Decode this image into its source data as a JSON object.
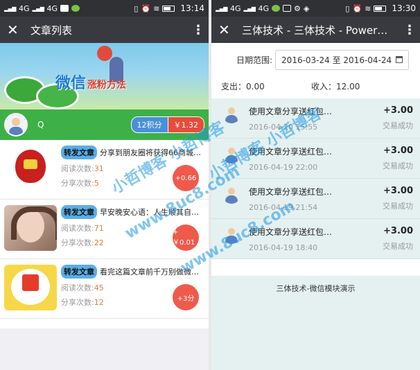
{
  "left": {
    "status": {
      "carrier1": "4G",
      "carrier2": "4G",
      "time": "13:14"
    },
    "nav": {
      "close": "✕",
      "title": "文章列表",
      "more": "⋮"
    },
    "banner": {
      "text": "微信",
      "subtext": "涨粉方法"
    },
    "user": {
      "name": "Q",
      "points": "12积分",
      "money": "￥1.32"
    },
    "articles": [
      {
        "tag": "转发文章",
        "title": "分享到朋友圈将获得66商城…",
        "read_label": "阅读次数:",
        "read": "31",
        "share_label": "分享次数:",
        "share": "5",
        "reward": "+0.66"
      },
      {
        "tag": "转发文章",
        "title": "早安晚安心语：人生顺其自…",
        "read_label": "阅读次数:",
        "read": "71",
        "share_label": "分享次数:",
        "share": "22",
        "reward": "+￥0.01"
      },
      {
        "tag": "转发文章",
        "title": "看完这篇文章前千万别做微…",
        "read_label": "阅读次数:",
        "read": "45",
        "share_label": "分享次数:",
        "share": "12",
        "reward": "+3分"
      }
    ]
  },
  "right": {
    "status": {
      "carrier1": "4G",
      "carrier2": "4G",
      "time": "13:30"
    },
    "nav": {
      "close": "✕",
      "title": "三体技术 - 三体技术 - Power…",
      "more": "⋮"
    },
    "date_label": "日期范围:",
    "date_value": "2016-03-24 至 2016-04-24",
    "summary": {
      "out_label": "支出：",
      "out": "0.00",
      "in_label": "收入：",
      "in": "12.00"
    },
    "records": [
      {
        "title": "使用文章分享送红包…",
        "date": "2016-04-20 15:55",
        "amount": "+3.00",
        "status": "交易成功"
      },
      {
        "title": "使用文章分享送红包…",
        "date": "2016-04-19 22:00",
        "amount": "+3.00",
        "status": "交易成功"
      },
      {
        "title": "使用文章分享送红包…",
        "date": "2016-04-19 21:54",
        "amount": "+3.00",
        "status": "交易成功"
      },
      {
        "title": "使用文章分享送红包…",
        "date": "2016-04-19 18:40",
        "amount": "+3.00",
        "status": "交易成功"
      }
    ],
    "footer": "三体技术-微信模块演示"
  },
  "watermark": {
    "line1": "小哲博客 小哲博客",
    "line2": "www.8uc8.com",
    "line3": "小哲博客 小哲博客"
  },
  "colors": {
    "navbar": "#393a3f",
    "statusbar": "#2f3135",
    "green": "#3db048",
    "tagblue": "#5aaee8",
    "coinred": "#ef5a4a",
    "recordbg": "#e4f1f0"
  }
}
